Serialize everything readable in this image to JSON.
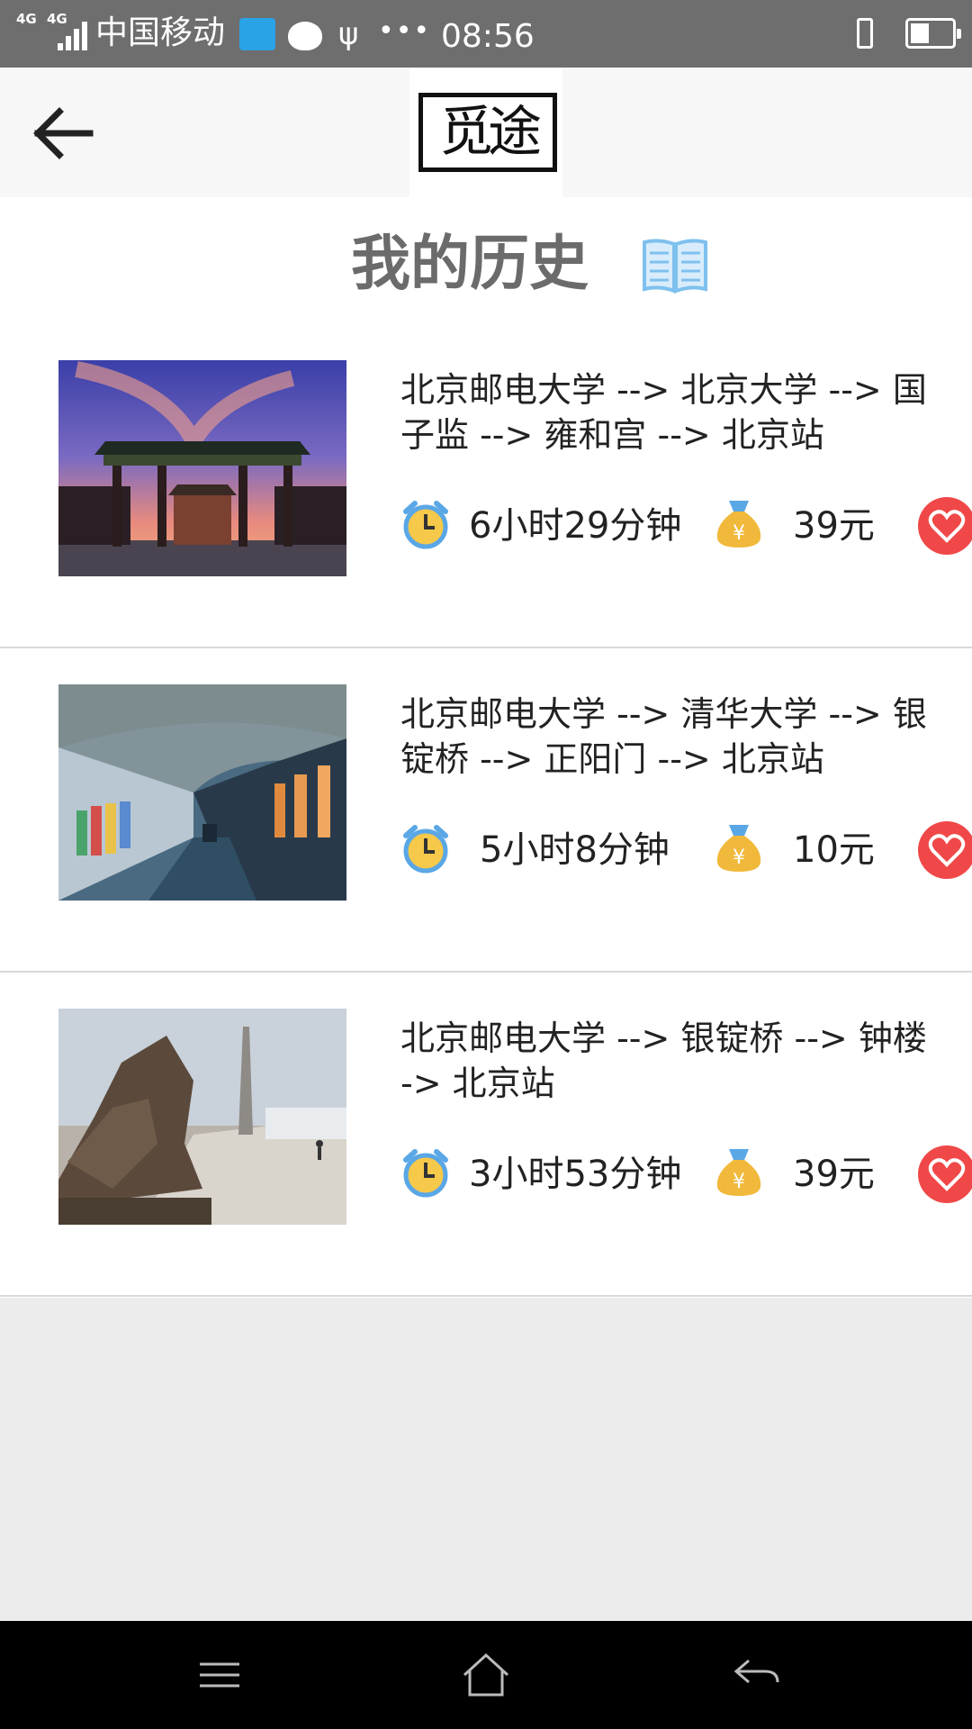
{
  "status_bar": {
    "network_1": "4G",
    "network_2": "4G",
    "carrier": "中国移动",
    "time": "08:56",
    "icons": [
      "signal-icon",
      "weather-icon",
      "cat-icon",
      "usb-icon",
      "more-dots-icon",
      "vibrate-icon",
      "battery-icon"
    ]
  },
  "header": {
    "back_icon": "arrow-left-icon",
    "logo_text": "觅途"
  },
  "page": {
    "title": "我的历史",
    "title_icon": "open-book-icon"
  },
  "routes": [
    {
      "route": "北京邮电大学 --> 北京大学 --> 国子监 --> 雍和宫 --> 北京站",
      "route_display": "北京邮电大学 --> 北京大学 --> 国\n子监 --> 雍和宫 --> 北京站",
      "duration": "6小时29分钟",
      "price": "39元",
      "image": "gate-at-sunset-photo"
    },
    {
      "route": "北京邮电大学 --> 清华大学 --> 银锭桥 --> 正阳门 --> 北京站",
      "route_display": "北京邮电大学 --> 清华大学 --> 银\n锭桥 --> 正阳门 --> 北京站",
      "duration": "5小时8分钟",
      "price": "10元",
      "image": "museum-corridor-photo"
    },
    {
      "route": "北京邮电大学 --> 银锭桥 --> 钟楼 -> 北京站",
      "route_display": "北京邮电大学 --> 银锭桥 --> 钟楼\n-> 北京站",
      "duration": "3小时53分钟",
      "price": "39元",
      "image": "statue-plaza-photo"
    }
  ],
  "nav_bar": {
    "icons": [
      "menu-icon",
      "home-icon",
      "back-icon"
    ]
  },
  "colors": {
    "status_bar": "#6e6e6e",
    "title_gray": "#6b6b6b",
    "favorite_red": "#f04848",
    "clock_yellow": "#f6c94a",
    "clock_blue": "#5aa7e6",
    "money_yellow": "#f1b93b",
    "book_blue": "#7ec0ee"
  }
}
